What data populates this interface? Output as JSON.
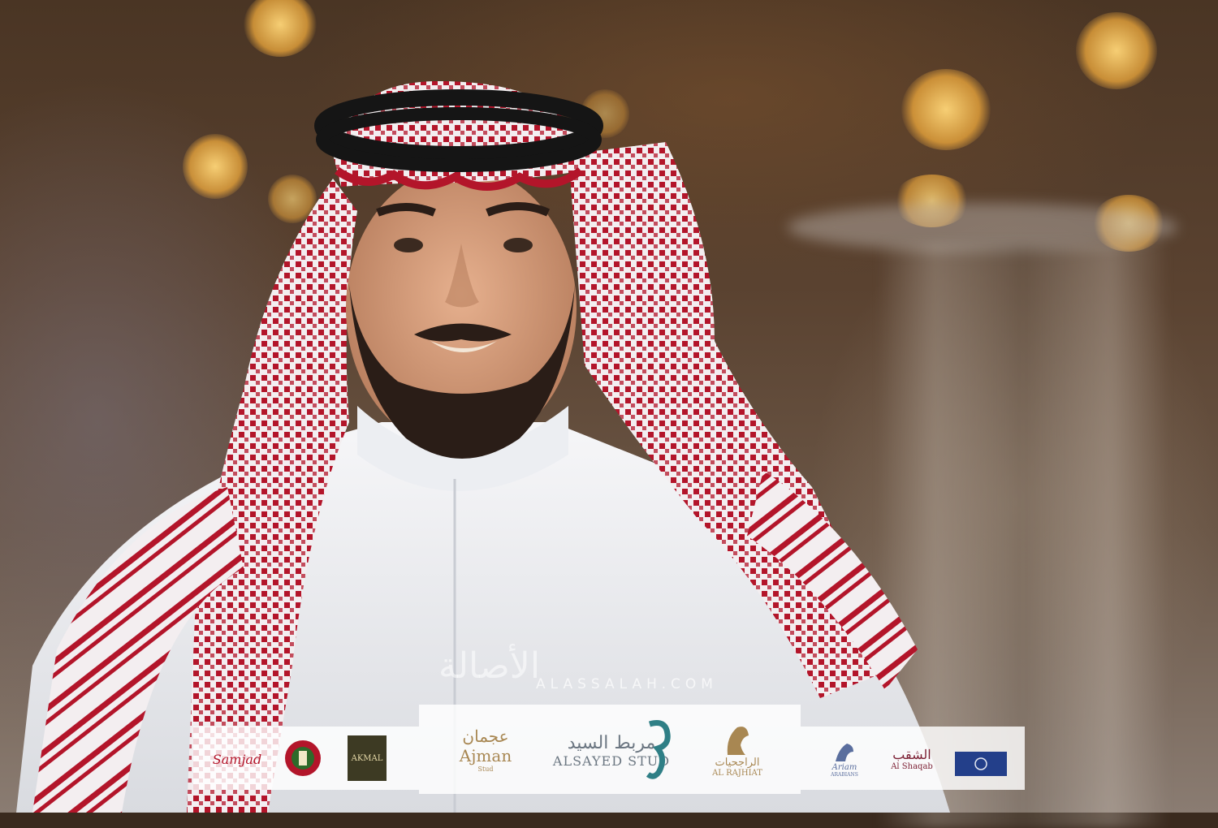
{
  "watermark": {
    "arabic": "الأصالة",
    "site": "ALASSALAH.COM"
  },
  "sponsors": {
    "samjad": "Samjad",
    "akmal": "AKMAL",
    "ajman_arabic": "عجمان",
    "ajman": "Ajman",
    "ajman_sub": "Stud",
    "alsayed_arabic": "مربط السيد",
    "alsayed": "ALSAYED STUD",
    "alrajhiat_arabic": "الراجحيات",
    "alrajhiat": "AL RAJHIAT",
    "alshaqab_arabic": "الشقب",
    "alshaqab": "Al Shaqab",
    "ariam": "Ariam",
    "ariam_sub": "ARABIANS"
  },
  "colors": {
    "shemagh_red": "#b3152a",
    "thobe_white": "#f4f4f6",
    "agal_black": "#151515",
    "brand_gold": "#a88752"
  }
}
